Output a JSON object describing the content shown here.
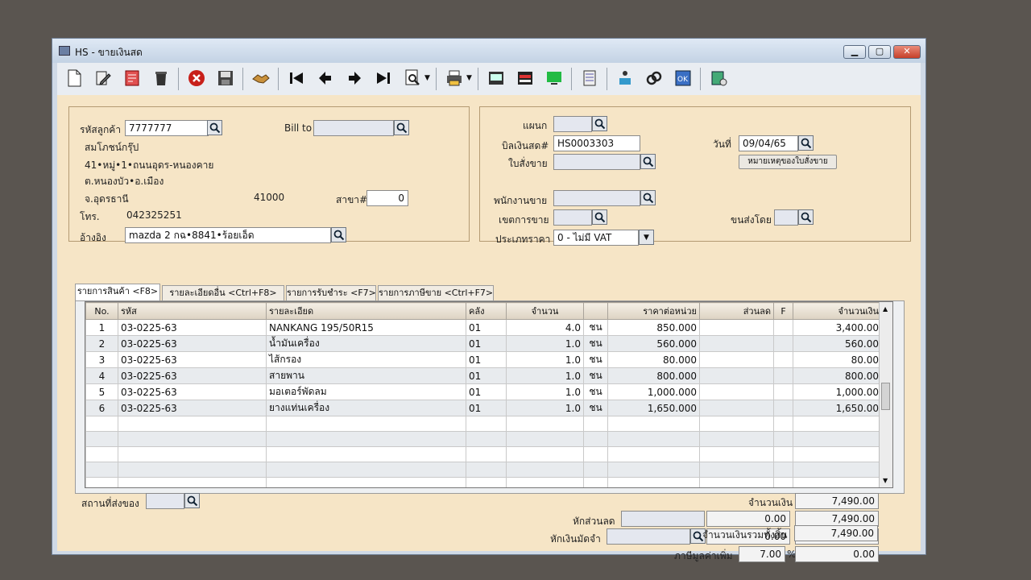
{
  "window": {
    "title": "HS - ขายเงินสด"
  },
  "toolbar": {
    "icons": [
      "new-document-icon",
      "edit-icon",
      "print-preview-icon",
      "delete-icon",
      "cancel-icon",
      "save-icon",
      "handshake-icon",
      "first-record-icon",
      "previous-record-icon",
      "next-record-icon",
      "last-record-icon",
      "search-icon",
      "printer-icon",
      "report-icon",
      "tray-icon",
      "monitor-icon",
      "calculator-icon",
      "approve-icon",
      "link-icon",
      "ok-icon",
      "database-icon"
    ]
  },
  "customer": {
    "code_label": "รหัสลูกค้า",
    "code": "7777777",
    "name": "สมโภชน์กรุ๊ป",
    "address1": "41•หมู่•1•ถนนอุดร-หนองคาย",
    "address2": "ต.หนองบัว•อ.เมือง",
    "province": "จ.อุดรธานี",
    "postcode": "41000",
    "phone_label": "โทร.",
    "phone": "042325251",
    "branch_label": "สาขา#",
    "branch": "0",
    "billto_label": "Bill to",
    "billto": "",
    "ref_label": "อ้างอิง",
    "ref": "mazda 2 กฉ•8841•ร้อยเอ็ด"
  },
  "doc": {
    "dept_label": "แผนก",
    "dept": "",
    "bill_label": "บิลเงินสด#",
    "bill": "HS0003303",
    "date_label": "วันที่",
    "date": "09/04/65",
    "order_label": "ใบสั่งขาย",
    "order": "",
    "order_note_btn": "หมายเหตุของใบสั่งขาย",
    "sales_label": "พนักงานขาย",
    "sales": "",
    "area_label": "เขตการขาย",
    "area": "",
    "ship_label": "ขนส่งโดย",
    "ship": "",
    "price_type_label": "ประเภทราคา",
    "price_type": "0 - ไม่มี VAT"
  },
  "tabs": [
    {
      "label": "รายการสินค้า <F8>",
      "active": true
    },
    {
      "label": "รายละเอียดอื่น <Ctrl+F8>"
    },
    {
      "label": "รายการรับชำระ <F7>"
    },
    {
      "label": "รายการภาษีขาย <Ctrl+F7>"
    }
  ],
  "grid": {
    "headers": [
      "No.",
      "รหัส",
      "รายละเอียด",
      "คลัง",
      "จำนวน",
      "",
      "ราคาต่อหน่วย",
      "ส่วนลด",
      "F",
      "จำนวนเงิน"
    ],
    "rows": [
      [
        "1",
        "03-0225-63",
        "NANKANG 195/50R15",
        "01",
        "4.0",
        "ชน",
        "850.000",
        "",
        "",
        "3,400.00"
      ],
      [
        "2",
        "03-0225-63",
        "น้ำมันเครื่อง",
        "01",
        "1.0",
        "ชน",
        "560.000",
        "",
        "",
        "560.00"
      ],
      [
        "3",
        "03-0225-63",
        "ไส้กรอง",
        "01",
        "1.0",
        "ชน",
        "80.000",
        "",
        "",
        "80.00"
      ],
      [
        "4",
        "03-0225-63",
        "สายพาน",
        "01",
        "1.0",
        "ชน",
        "800.000",
        "",
        "",
        "800.00"
      ],
      [
        "5",
        "03-0225-63",
        "มอเตอร์พัดลม",
        "01",
        "1.0",
        "ชน",
        "1,000.000",
        "",
        "",
        "1,000.00"
      ],
      [
        "6",
        "03-0225-63",
        "ยางแท่นเครื่อง",
        "01",
        "1.0",
        "ชน",
        "1,650.000",
        "",
        "",
        "1,650.00"
      ]
    ],
    "empty_rows": 5
  },
  "footer": {
    "ship_place_label": "สถานที่ส่งของ",
    "ship_place": "",
    "amount_label": "จำนวนเงิน",
    "amount": "7,490.00",
    "discount_label": "หักส่วนลด",
    "discount_value": "0.00",
    "after_discount": "7,490.00",
    "deposit_label": "หักเงินมัดจำ",
    "deposit_value": "0.00",
    "after_deposit": "7,490.00",
    "vat_label": "ภาษีมูลค่าเพิ่ม",
    "vat_rate": "7.00",
    "vat_pct": "%",
    "vat_value": "0.00",
    "total_label": "จำนวนเงินรวมทั้งสิ้น",
    "total": "7,490.00"
  },
  "colors": {
    "form_bg": "#f6e5c6",
    "window_frame": "#cfd9e6"
  }
}
